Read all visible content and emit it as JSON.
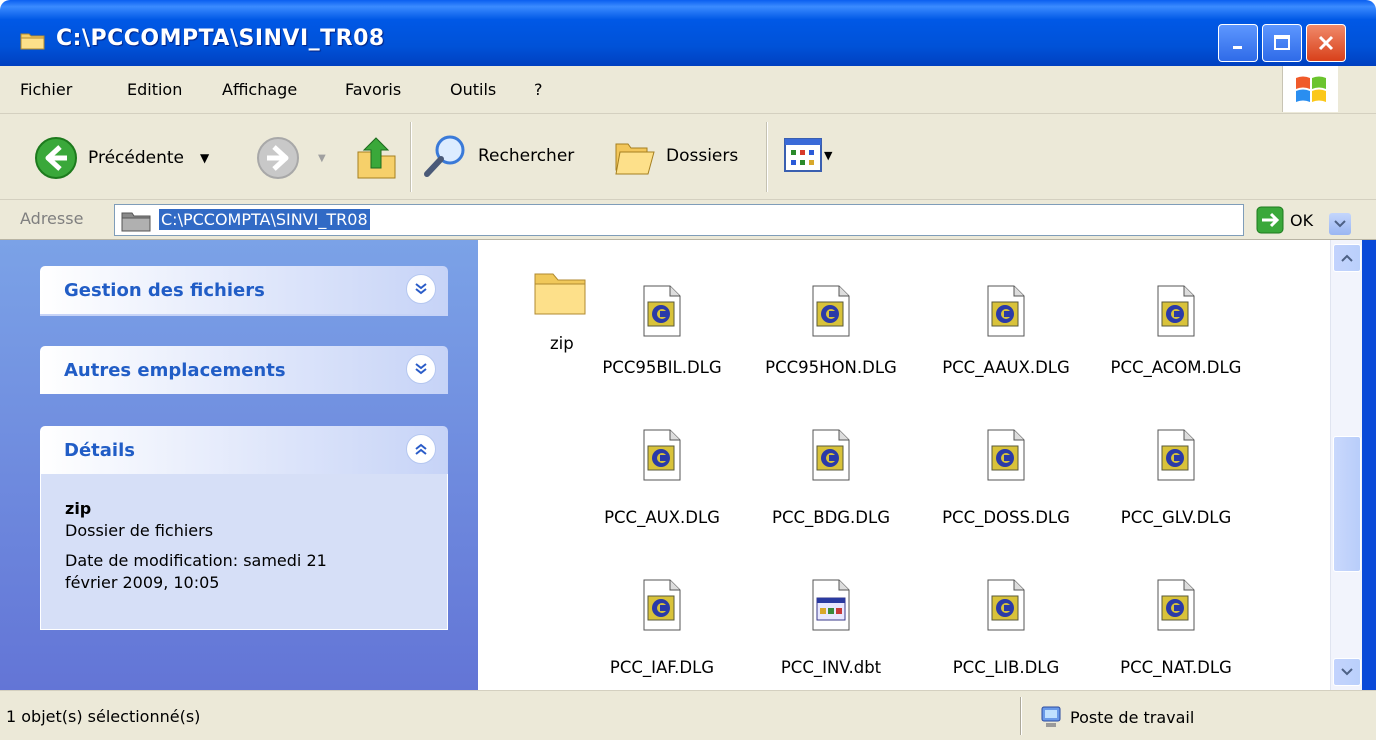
{
  "window": {
    "title": "C:\\PCCOMPTA\\SINVI_TR08"
  },
  "menu": [
    {
      "label": "Fichier"
    },
    {
      "label": "Edition"
    },
    {
      "label": "Affichage"
    },
    {
      "label": "Favoris"
    },
    {
      "label": "Outils"
    },
    {
      "label": "?"
    }
  ],
  "toolbar": {
    "back_label": "Précédente",
    "search_label": "Rechercher",
    "folders_label": "Dossiers"
  },
  "address": {
    "label": "Adresse",
    "value": "C:\\PCCOMPTA\\SINVI_TR08",
    "go_label": "OK"
  },
  "tasks": {
    "panels": [
      {
        "title": "Gestion des fichiers"
      },
      {
        "title": "Autres emplacements"
      },
      {
        "title": "Détails"
      }
    ],
    "details": {
      "name": "zip",
      "type": "Dossier de fichiers",
      "modified_line1": "Date de modification: samedi 21",
      "modified_line2": "février 2009, 10:05"
    }
  },
  "files": [
    {
      "name": "zip",
      "kind": "folder"
    },
    {
      "name": "PCC95BIL.DLG",
      "kind": "dlg"
    },
    {
      "name": "PCC95HON.DLG",
      "kind": "dlg"
    },
    {
      "name": "PCC_AAUX.DLG",
      "kind": "dlg"
    },
    {
      "name": "PCC_ACOM.DLG",
      "kind": "dlg"
    },
    {
      "name": "PCC_AUX.DLG",
      "kind": "dlg"
    },
    {
      "name": "PCC_BDG.DLG",
      "kind": "dlg"
    },
    {
      "name": "PCC_DOSS.DLG",
      "kind": "dlg"
    },
    {
      "name": "PCC_GLV.DLG",
      "kind": "dlg"
    },
    {
      "name": "PCC_IAF.DLG",
      "kind": "dlg"
    },
    {
      "name": "PCC_INV.dbt",
      "kind": "dbt"
    },
    {
      "name": "PCC_LIB.DLG",
      "kind": "dlg"
    },
    {
      "name": "PCC_NAT.DLG",
      "kind": "dlg"
    }
  ],
  "status": {
    "left": "1 objet(s) sélectionné(s)",
    "right": "Poste de travail"
  },
  "colors": {
    "titlebar": "#0058e6",
    "taskpane": "#6f8ede",
    "selection": "#316ac5",
    "panel_title": "#215dc6"
  }
}
